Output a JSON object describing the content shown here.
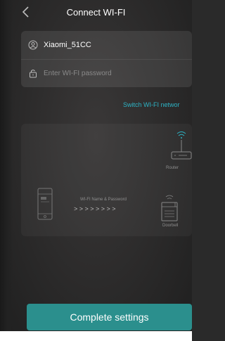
{
  "header": {
    "title": "Connect WI-FI",
    "back_icon": "chevron-left-icon"
  },
  "network": {
    "ssid": "Xiaomi_51CC",
    "ssid_icon": "user-circle-icon",
    "password_placeholder": "Enter WI-FI password",
    "password_value": "",
    "password_icon": "lock-icon",
    "switch_label": "Switch WI-FI networ"
  },
  "diagram": {
    "phone_icon": "phone-icon",
    "wifi_label": "WI-FI Name & Password",
    "arrows": ">  >  >  >  >  >  >  >",
    "router_label": "Router",
    "device_label": "Doorbell",
    "router_icon": "router-icon",
    "device_icon": "doorbell-icon",
    "wifi_icon": "wifi-icon"
  },
  "footer": {
    "complete_label": "Complete settings"
  },
  "colors": {
    "accent": "#2db3c5",
    "button": "#2b8f8d"
  }
}
